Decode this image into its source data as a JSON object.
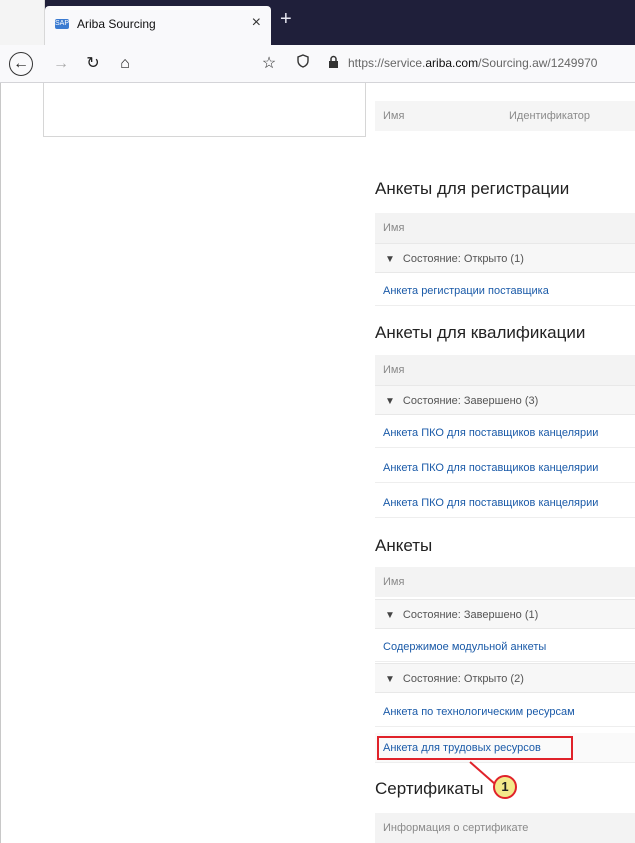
{
  "browser": {
    "tab_title": "Ariba Sourcing",
    "favicon_text": "SAP",
    "tab_close": "×",
    "new_tab": "+",
    "url_prefix": "https://service.",
    "url_domain": "ariba.com",
    "url_suffix": "/Sourcing.aw/1249970"
  },
  "top_table": {
    "col_name": "Имя",
    "col_id": "Идентификатор"
  },
  "registration": {
    "title": "Анкеты для регистрации",
    "header": "Имя",
    "group_label": "Состояние: Открыто  (1)",
    "items": [
      "Анкета регистрации поставщика"
    ]
  },
  "qualification": {
    "title": "Анкеты для квалификации",
    "header": "Имя",
    "group_label": "Состояние: Завершено  (3)",
    "items": [
      "Анкета ПКО для поставщиков канцелярии",
      "Анкета ПКО для поставщиков канцелярии",
      "Анкета ПКО для поставщиков канцелярии"
    ]
  },
  "questionnaires": {
    "title": "Анкеты",
    "header": "Имя",
    "group_completed": "Состояние: Завершено  (1)",
    "completed_items": [
      "Содержимое модульной анкеты"
    ],
    "group_open": "Состояние: Открыто  (2)",
    "open_items": [
      "Анкета по технологическим ресурсам",
      "Анкета для трудовых ресурсов"
    ]
  },
  "certificates": {
    "title": "Сертификаты",
    "header": "Информация о сертификате"
  },
  "callout": {
    "number": "1",
    "color": "#e0222a"
  }
}
